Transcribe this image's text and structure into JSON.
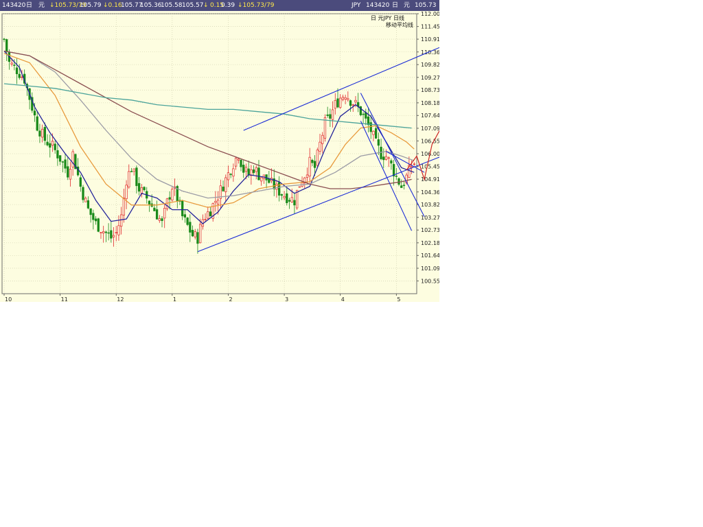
{
  "header": {
    "left": [
      {
        "text": "143420",
        "color": "white"
      },
      {
        "text": "日",
        "color": "white"
      },
      {
        "text": "元",
        "color": "white"
      },
      {
        "text": "↓105.73/79",
        "color": "yellow"
      },
      {
        "text": "105.79",
        "color": "white"
      },
      {
        "text": "↓0.16",
        "color": "yellow"
      },
      {
        "text": "105.77",
        "color": "white"
      },
      {
        "text": "105.36",
        "color": "white"
      },
      {
        "text": "105.58",
        "color": "white"
      },
      {
        "text": "105.57",
        "color": "white"
      },
      {
        "text": "↓",
        "color": "yellow"
      },
      {
        "text": "0.15",
        "color": "yellow"
      },
      {
        "text": "0.39",
        "color": "white"
      },
      {
        "text": "↓105.73/79",
        "color": "yellow"
      }
    ],
    "right": [
      {
        "text": "JPY"
      },
      {
        "text": "143420"
      },
      {
        "text": "日"
      },
      {
        "text": "元"
      },
      {
        "text": "105.73"
      }
    ]
  },
  "legend": {
    "line1": "日    元JPY    日线",
    "line2": "移动平均线"
  },
  "chart_data": {
    "type": "candlestick",
    "instrument": "JPY",
    "ylim": [
      100.0,
      112.0
    ],
    "y_ticks": [
      "112.00",
      "111.45",
      "110.91",
      "110.36",
      "109.82",
      "109.27",
      "108.73",
      "108.18",
      "107.64",
      "107.09",
      "106.55",
      "106.00",
      "105.45",
      "104.91",
      "104.36",
      "103.82",
      "103.27",
      "102.73",
      "102.18",
      "101.64",
      "101.09",
      "100.55"
    ],
    "x_ticks": [
      {
        "label": "10",
        "index": 0
      },
      {
        "label": "11",
        "index": 22
      },
      {
        "label": "12",
        "index": 44
      },
      {
        "label": "1",
        "index": 66
      },
      {
        "label": "2",
        "index": 88
      },
      {
        "label": "3",
        "index": 110
      },
      {
        "label": "4",
        "index": 132
      },
      {
        "label": "5",
        "index": 154
      }
    ],
    "candles_count": 162,
    "close_path": [
      [
        0,
        110.9
      ],
      [
        2,
        109.9
      ],
      [
        5,
        109.6
      ],
      [
        8,
        109.2
      ],
      [
        10,
        108.4
      ],
      [
        13,
        107.2
      ],
      [
        16,
        106.6
      ],
      [
        19,
        106.3
      ],
      [
        22,
        105.8
      ],
      [
        25,
        105.2
      ],
      [
        27,
        106.0
      ],
      [
        30,
        104.6
      ],
      [
        33,
        103.6
      ],
      [
        36,
        103.0
      ],
      [
        39,
        102.7
      ],
      [
        42,
        102.4
      ],
      [
        44,
        102.6
      ],
      [
        46,
        103.3
      ],
      [
        48,
        104.9
      ],
      [
        50,
        105.4
      ],
      [
        53,
        104.5
      ],
      [
        56,
        104.1
      ],
      [
        59,
        103.6
      ],
      [
        62,
        103.0
      ],
      [
        64,
        103.9
      ],
      [
        66,
        104.6
      ],
      [
        68,
        104.1
      ],
      [
        70,
        103.3
      ],
      [
        72,
        102.9
      ],
      [
        74,
        102.5
      ],
      [
        76,
        102.4
      ],
      [
        78,
        103.2
      ],
      [
        81,
        103.6
      ],
      [
        84,
        104.2
      ],
      [
        87,
        104.9
      ],
      [
        90,
        105.6
      ],
      [
        92,
        106.0
      ],
      [
        94,
        105.3
      ],
      [
        96,
        105.1
      ],
      [
        98,
        105.4
      ],
      [
        100,
        105.1
      ],
      [
        103,
        104.9
      ],
      [
        106,
        104.6
      ],
      [
        109,
        104.3
      ],
      [
        112,
        104.1
      ],
      [
        114,
        104.0
      ],
      [
        116,
        104.7
      ],
      [
        118,
        105.1
      ],
      [
        120,
        105.6
      ],
      [
        122,
        105.4
      ],
      [
        124,
        106.4
      ],
      [
        126,
        107.3
      ],
      [
        128,
        107.6
      ],
      [
        130,
        108.1
      ],
      [
        132,
        108.4
      ],
      [
        134,
        108.6
      ],
      [
        136,
        108.3
      ],
      [
        138,
        108.1
      ],
      [
        140,
        107.8
      ],
      [
        142,
        107.4
      ],
      [
        144,
        107.0
      ],
      [
        146,
        106.4
      ],
      [
        148,
        106.0
      ],
      [
        150,
        105.9
      ],
      [
        152,
        105.5
      ],
      [
        154,
        105.0
      ],
      [
        156,
        104.6
      ],
      [
        158,
        105.0
      ],
      [
        160,
        105.5
      ],
      [
        161,
        105.6
      ]
    ],
    "moving_averages": [
      {
        "color": "#222299",
        "points": [
          [
            0,
            110.4
          ],
          [
            6,
            109.7
          ],
          [
            12,
            108.0
          ],
          [
            18,
            106.9
          ],
          [
            24,
            106.0
          ],
          [
            30,
            105.2
          ],
          [
            36,
            104.0
          ],
          [
            42,
            103.1
          ],
          [
            48,
            103.2
          ],
          [
            54,
            104.3
          ],
          [
            60,
            104.1
          ],
          [
            66,
            103.6
          ],
          [
            72,
            103.6
          ],
          [
            78,
            103.0
          ],
          [
            84,
            103.5
          ],
          [
            90,
            104.4
          ],
          [
            96,
            105.1
          ],
          [
            102,
            105.0
          ],
          [
            108,
            104.8
          ],
          [
            114,
            104.3
          ],
          [
            120,
            104.6
          ],
          [
            126,
            106.2
          ],
          [
            132,
            107.6
          ],
          [
            138,
            108.1
          ],
          [
            144,
            107.6
          ],
          [
            150,
            106.5
          ],
          [
            156,
            105.4
          ],
          [
            161,
            105.2
          ]
        ]
      },
      {
        "color": "#e89a3c",
        "points": [
          [
            0,
            110.3
          ],
          [
            10,
            109.9
          ],
          [
            20,
            108.5
          ],
          [
            30,
            106.3
          ],
          [
            40,
            104.7
          ],
          [
            50,
            103.8
          ],
          [
            60,
            103.8
          ],
          [
            70,
            104.0
          ],
          [
            80,
            103.7
          ],
          [
            90,
            103.9
          ],
          [
            100,
            104.5
          ],
          [
            110,
            104.7
          ],
          [
            120,
            104.8
          ],
          [
            128,
            105.4
          ],
          [
            134,
            106.4
          ],
          [
            140,
            107.1
          ],
          [
            146,
            107.2
          ],
          [
            152,
            106.9
          ],
          [
            158,
            106.5
          ],
          [
            161,
            106.2
          ]
        ]
      },
      {
        "color": "#9c9ca6",
        "points": [
          [
            0,
            110.4
          ],
          [
            10,
            110.2
          ],
          [
            20,
            109.5
          ],
          [
            30,
            108.3
          ],
          [
            40,
            107.0
          ],
          [
            50,
            105.8
          ],
          [
            60,
            104.9
          ],
          [
            70,
            104.4
          ],
          [
            80,
            104.1
          ],
          [
            90,
            104.2
          ],
          [
            100,
            104.4
          ],
          [
            110,
            104.6
          ],
          [
            120,
            104.7
          ],
          [
            130,
            105.2
          ],
          [
            140,
            105.9
          ],
          [
            150,
            106.1
          ],
          [
            156,
            105.9
          ],
          [
            161,
            105.7
          ]
        ]
      },
      {
        "color": "#8a4e50",
        "points": [
          [
            0,
            110.4
          ],
          [
            10,
            110.2
          ],
          [
            20,
            109.6
          ],
          [
            30,
            109.0
          ],
          [
            40,
            108.4
          ],
          [
            50,
            107.8
          ],
          [
            60,
            107.3
          ],
          [
            70,
            106.8
          ],
          [
            80,
            106.3
          ],
          [
            90,
            105.9
          ],
          [
            100,
            105.5
          ],
          [
            110,
            105.1
          ],
          [
            120,
            104.7
          ],
          [
            128,
            104.5
          ],
          [
            136,
            104.5
          ],
          [
            144,
            104.6
          ],
          [
            150,
            104.7
          ],
          [
            156,
            104.8
          ],
          [
            160,
            104.9
          ]
        ]
      },
      {
        "color": "#4aa39a",
        "points": [
          [
            0,
            109.0
          ],
          [
            10,
            108.9
          ],
          [
            20,
            108.8
          ],
          [
            30,
            108.6
          ],
          [
            40,
            108.4
          ],
          [
            50,
            108.3
          ],
          [
            60,
            108.1
          ],
          [
            70,
            108.0
          ],
          [
            80,
            107.9
          ],
          [
            90,
            107.9
          ],
          [
            100,
            107.8
          ],
          [
            110,
            107.7
          ],
          [
            120,
            107.5
          ],
          [
            130,
            107.4
          ],
          [
            140,
            107.3
          ],
          [
            150,
            107.2
          ],
          [
            160,
            107.1
          ]
        ]
      }
    ],
    "trendlines": [
      {
        "color": "#1a2bd6",
        "from": [
          76,
          101.8
        ],
        "to": [
          172,
          105.9
        ]
      },
      {
        "color": "#1a2bd6",
        "from": [
          94,
          107.0
        ],
        "to": [
          172,
          110.6
        ]
      },
      {
        "color": "#1a2bd6",
        "from": [
          140,
          108.6
        ],
        "to": [
          165,
          103.3
        ]
      },
      {
        "color": "#1a2bd6",
        "from": [
          140,
          107.4
        ],
        "to": [
          160,
          102.7
        ]
      },
      {
        "color": "#1a2bd6",
        "from": [
          150,
          106.1
        ],
        "to": [
          165,
          105.2
        ]
      }
    ],
    "forecast": {
      "color": "#cc2222",
      "points": [
        [
          158,
          105.3
        ],
        [
          162,
          105.9
        ],
        [
          165,
          104.9
        ],
        [
          168,
          106.4
        ],
        [
          171,
          107.0
        ]
      ]
    }
  }
}
